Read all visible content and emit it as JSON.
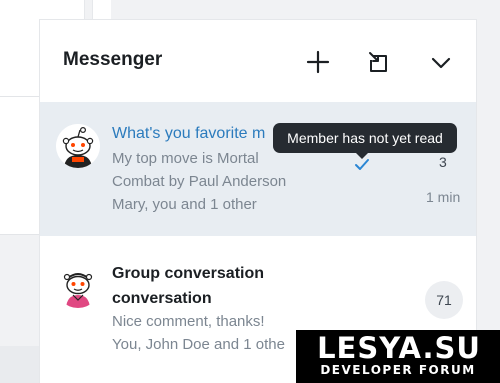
{
  "messenger": {
    "title": "Messenger",
    "actions": [
      {
        "name": "new-conversation",
        "icon": "plus-icon"
      },
      {
        "name": "popout",
        "icon": "open-in-new-window-icon"
      },
      {
        "name": "collapse",
        "icon": "chevron-down-icon"
      }
    ],
    "conversations": [
      {
        "title": "What's you favorite m",
        "preview_lines": [
          "My top move is Mortal",
          "Combat by Paul Anderson"
        ],
        "participants": "Mary, you and 1 other",
        "unread_count": "3",
        "time": "1 min",
        "read_status_icon": "checkmark-icon",
        "selected": true,
        "avatar": "snoo-avatar"
      },
      {
        "title_lines": [
          "Group conversation",
          "conversation"
        ],
        "preview": "Nice comment, thanks!",
        "participants": "You, John Doe and 1 othe",
        "count": "71",
        "selected": false,
        "avatar": "snoo-avatar"
      }
    ],
    "tooltip": "Member has not yet read"
  },
  "watermark": {
    "name": "LESYA.SU",
    "subtitle": "DEVELOPER FORUM"
  },
  "colors": {
    "selected_row": "#e8edf2",
    "link_blue": "#2b7bbd",
    "check_blue": "#2a86d4",
    "tooltip_bg": "#262b31",
    "muted_text": "#7c8691"
  }
}
